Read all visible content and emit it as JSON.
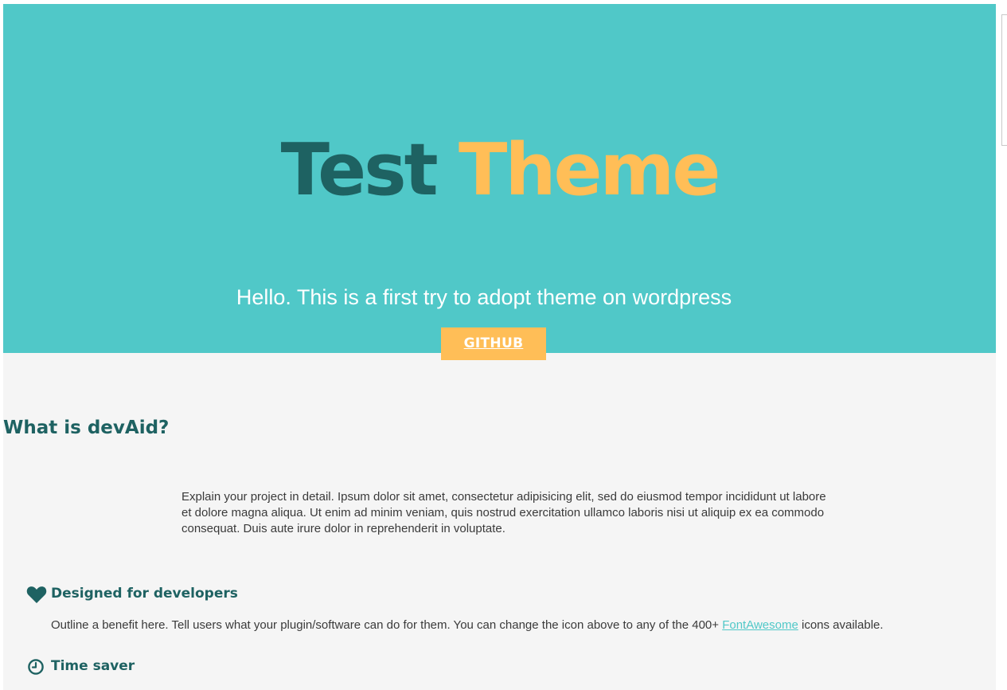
{
  "hero": {
    "title_first": "Test",
    "title_second": "Theme",
    "tagline": "Hello. This is a first try to adopt theme on wordpress",
    "button_label": "GITHUB"
  },
  "about": {
    "title": "What is devAid?",
    "intro": "Explain your project in detail. Ipsum dolor sit amet, consectetur adipisicing elit, sed do eiusmod tempor incididunt ut labore et dolore magna aliqua. Ut enim ad minim veniam, quis nostrud exercitation ullamco laboris nisi ut aliquip ex ea commodo consequat. Duis aute irure dolor in reprehenderit in voluptate."
  },
  "features": [
    {
      "icon": "heart-icon",
      "title": "Designed for developers",
      "desc_before": "Outline a benefit here. Tell users what your plugin/software can do for them. You can change the icon above to any of the 400+ ",
      "link": "FontAwesome",
      "desc_after": " icons available."
    },
    {
      "icon": "clock-icon",
      "title": "Time saver"
    }
  ],
  "colors": {
    "hero_bg": "#50c8c8",
    "dark_teal": "#1e6262",
    "accent_orange": "#ffbe57",
    "page_bg": "#f5f5f5"
  }
}
